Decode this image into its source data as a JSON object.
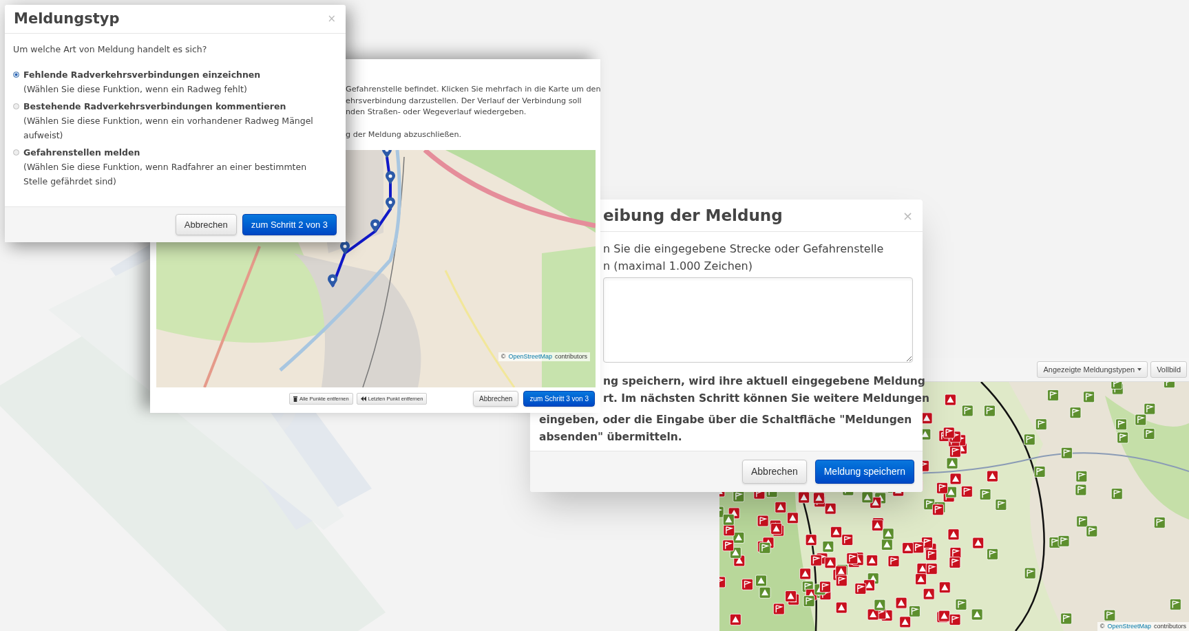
{
  "type_dialog": {
    "title": "Meldungstyp",
    "close": "×",
    "question": "Um welche Art von Meldung handelt es sich?",
    "options": [
      {
        "label": "Fehlende Radverkehrsverbindungen einzeichnen",
        "hint": "(Wählen Sie diese Funktion, wenn ein Radweg fehlt)",
        "selected": true
      },
      {
        "label": "Bestehende Radverkehrsverbindungen kommentieren",
        "hint": "(Wählen Sie diese Funktion, wenn ein vorhandener Radweg Mängel aufweist)",
        "selected": false
      },
      {
        "label": "Gefahrenstellen melden",
        "hint": "(Wählen Sie diese Funktion, wenn Radfahrer an einer bestimmten Stelle gefährdet sind)",
        "selected": false
      }
    ],
    "buttons": [
      {
        "label": "Abbrechen",
        "kind": "default"
      },
      {
        "label": "zum Schritt 2 von 3",
        "kind": "primary"
      }
    ]
  },
  "route_dialog": {
    "instructions": [
      [
        "Gefahrenstelle befindet. Klicken Sie mehrfach in die Karte um den",
        "ehrsverbindung darzustellen. Der Verlauf der Verbindung soll",
        "nden Straßen- oder Wegeverlauf wiedergeben."
      ],
      [
        "g der Meldung abzuschließen."
      ]
    ],
    "attribution": {
      "sign": "©",
      "link": "OpenStreetMap",
      "text": "contributors"
    },
    "tool_buttons": [
      {
        "label": "Alle Punkte entfernen",
        "kind": "trash"
      },
      {
        "label": "Letzten Punkt entfernen",
        "kind": "back"
      }
    ],
    "buttons": [
      {
        "label": "Abbrechen",
        "kind": "default"
      },
      {
        "label": "zum Schritt 3 von 3",
        "kind": "primary"
      }
    ]
  },
  "description_dialog": {
    "title": "eibung der Meldung",
    "close": "×",
    "prompt_lines": [
      "n Sie die eingegebene Strecke oder Gefahrenstelle",
      "n (maximal 1.000 Zeichen)"
    ],
    "notice_lines": [
      "ng speichern, wird ihre aktuell eingegebene Meldung",
      "rt. Im nächsten Schritt können Sie weitere Meldungen",
      "eingeben, oder die Eingabe über die Schaltfläche \"Meldungen",
      "absenden\" übermitteln."
    ],
    "buttons": [
      {
        "label": "Abbrechen",
        "kind": "default"
      },
      {
        "label": "Meldung speichern",
        "kind": "primary"
      }
    ]
  },
  "report_map": {
    "toolbar_buttons": [
      {
        "label": "Angezeigte Meldungstypen",
        "dropdown": true
      },
      {
        "label": "Vollbild",
        "dropdown": false
      }
    ],
    "attribution": {
      "sign": "©",
      "link": "OpenStreetMap",
      "text": "contributors"
    }
  }
}
